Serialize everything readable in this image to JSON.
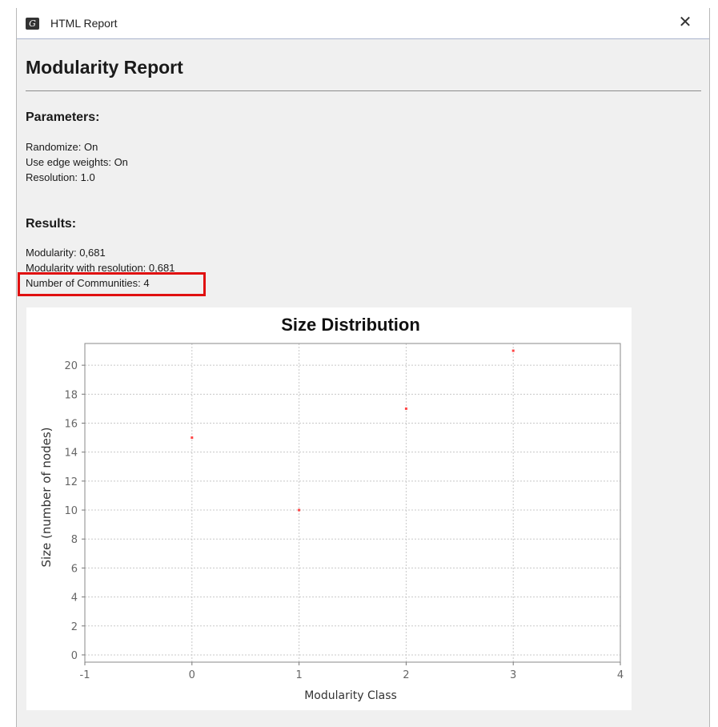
{
  "window": {
    "title": "HTML Report",
    "app_icon_glyph": "G",
    "close_glyph": "✕"
  },
  "report": {
    "title": "Modularity Report",
    "parameters_heading": "Parameters:",
    "parameters": {
      "randomize": "Randomize: On",
      "edge_weights": "Use edge weights: On",
      "resolution": "Resolution: 1.0"
    },
    "results_heading": "Results:",
    "results": {
      "modularity": "Modularity: 0,681",
      "modularity_resolution": "Modularity with resolution: 0,681",
      "communities": "Number of Communities: 4"
    }
  },
  "colors": {
    "highlight": "#e01010",
    "point": "#ff4444",
    "grid": "#c8c8c8"
  },
  "chart_data": {
    "type": "scatter",
    "title": "Size Distribution",
    "xlabel": "Modularity Class",
    "ylabel": "Size (number of nodes)",
    "xlim": [
      -1,
      4
    ],
    "ylim": [
      -0.5,
      21.5
    ],
    "xticks": [
      -1,
      0,
      1,
      2,
      3,
      4
    ],
    "yticks": [
      0,
      2,
      4,
      6,
      8,
      10,
      12,
      14,
      16,
      18,
      20
    ],
    "x": [
      0,
      1,
      2,
      3
    ],
    "y": [
      15,
      10,
      17,
      21
    ],
    "grid": true,
    "legend": false
  }
}
